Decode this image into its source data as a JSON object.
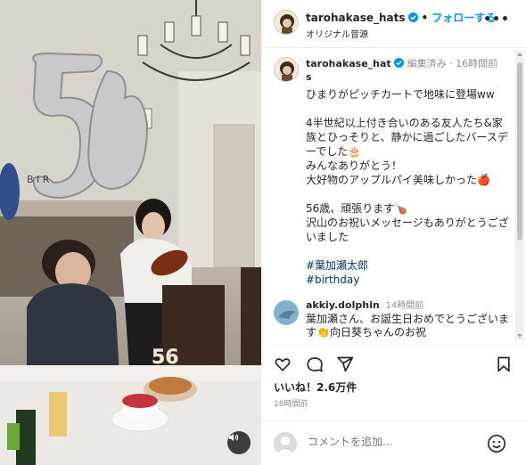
{
  "header": {
    "username": "tarohakase_hats",
    "follow_label": "フォローする",
    "separator": "•",
    "audio": "オリジナル音源",
    "more": "•••"
  },
  "caption": {
    "username": "tarohakase_hat",
    "username_tail": "s",
    "edited": "編集済み",
    "time": "16時間前",
    "lines": [
      "ひまりがピッチカートで地味に登場ww",
      "4半世紀以上付き合いのある友人たち&家族とひっそりと、静かに過ごしたバースデーでした🎂",
      "みんなありがとう！",
      "大好物のアップルパイ美味しかった🍎",
      "56歳、頑張ります🍗",
      "沢山のお祝いメッセージもありがとうございました"
    ],
    "hashtags": [
      "#葉加瀬太郎",
      "#birthday"
    ]
  },
  "reply": {
    "username": "akkiy.dolphin",
    "time": "14時間前",
    "text": "葉加瀬さん、お誕生日おめでとうございます👏向日葵ちゃんのお祝"
  },
  "actions": {
    "likes": "いいね！2.6万件",
    "time_ago": "18時間前"
  },
  "comment": {
    "placeholder": "コメントを追加..."
  },
  "media": {
    "candle_number": "56"
  }
}
